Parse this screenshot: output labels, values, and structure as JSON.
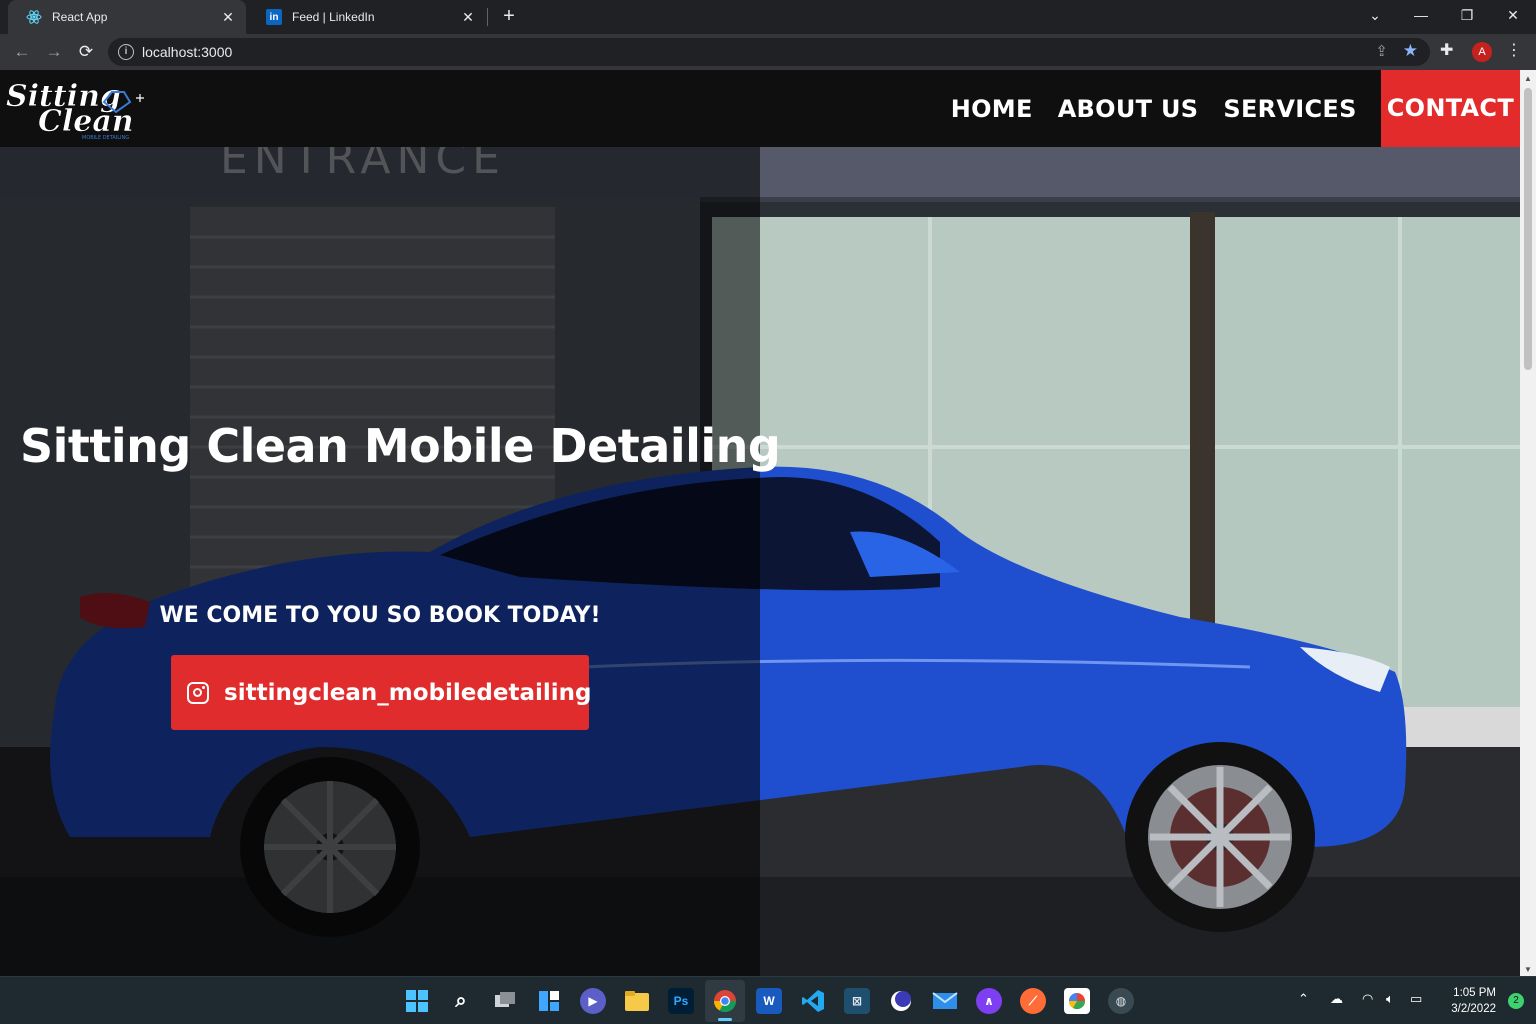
{
  "browser": {
    "tabs": [
      {
        "title": "React App",
        "favicon": "react-icon",
        "active": true
      },
      {
        "title": "Feed | LinkedIn",
        "favicon": "linkedin-icon",
        "active": false
      }
    ],
    "url": "localhost:3000",
    "profile_initial": "A",
    "accent_star": "#8ab4f8"
  },
  "site": {
    "logo": {
      "line1": "Sitting",
      "line2": "Clean",
      "tagline": "MOBILE DETAILING"
    },
    "nav": {
      "home": "HOME",
      "about": "ABOUT US",
      "services": "SERVICES",
      "contact": "CONTACT"
    },
    "hero": {
      "title": "Sitting Clean Mobile Detailing",
      "subtitle": "WE COME TO YOU SO BOOK TODAY!",
      "cta_label": "sittingclean_mobiledetailing",
      "cta_icon": "instagram-icon"
    },
    "colors": {
      "brand_red": "#e32b2b",
      "nav_bg": "#0f0f0f",
      "car_blue": "#1f4fcf"
    }
  },
  "taskbar": {
    "apps": [
      "windows-start-icon",
      "search-icon",
      "task-view-icon",
      "widgets-icon",
      "teams-chat-icon",
      "file-explorer-icon",
      "photoshop-icon",
      "chrome-icon",
      "word-icon",
      "vscode-icon",
      "mysql-workbench-icon",
      "eclipse-icon",
      "mail-icon",
      "arc-icon",
      "postman-icon",
      "colorpicker-icon",
      "mongodb-compass-icon"
    ],
    "photoshop_label": "Ps",
    "word_label": "W",
    "time": "1:05 PM",
    "date": "3/2/2022",
    "notification_count": "2"
  }
}
